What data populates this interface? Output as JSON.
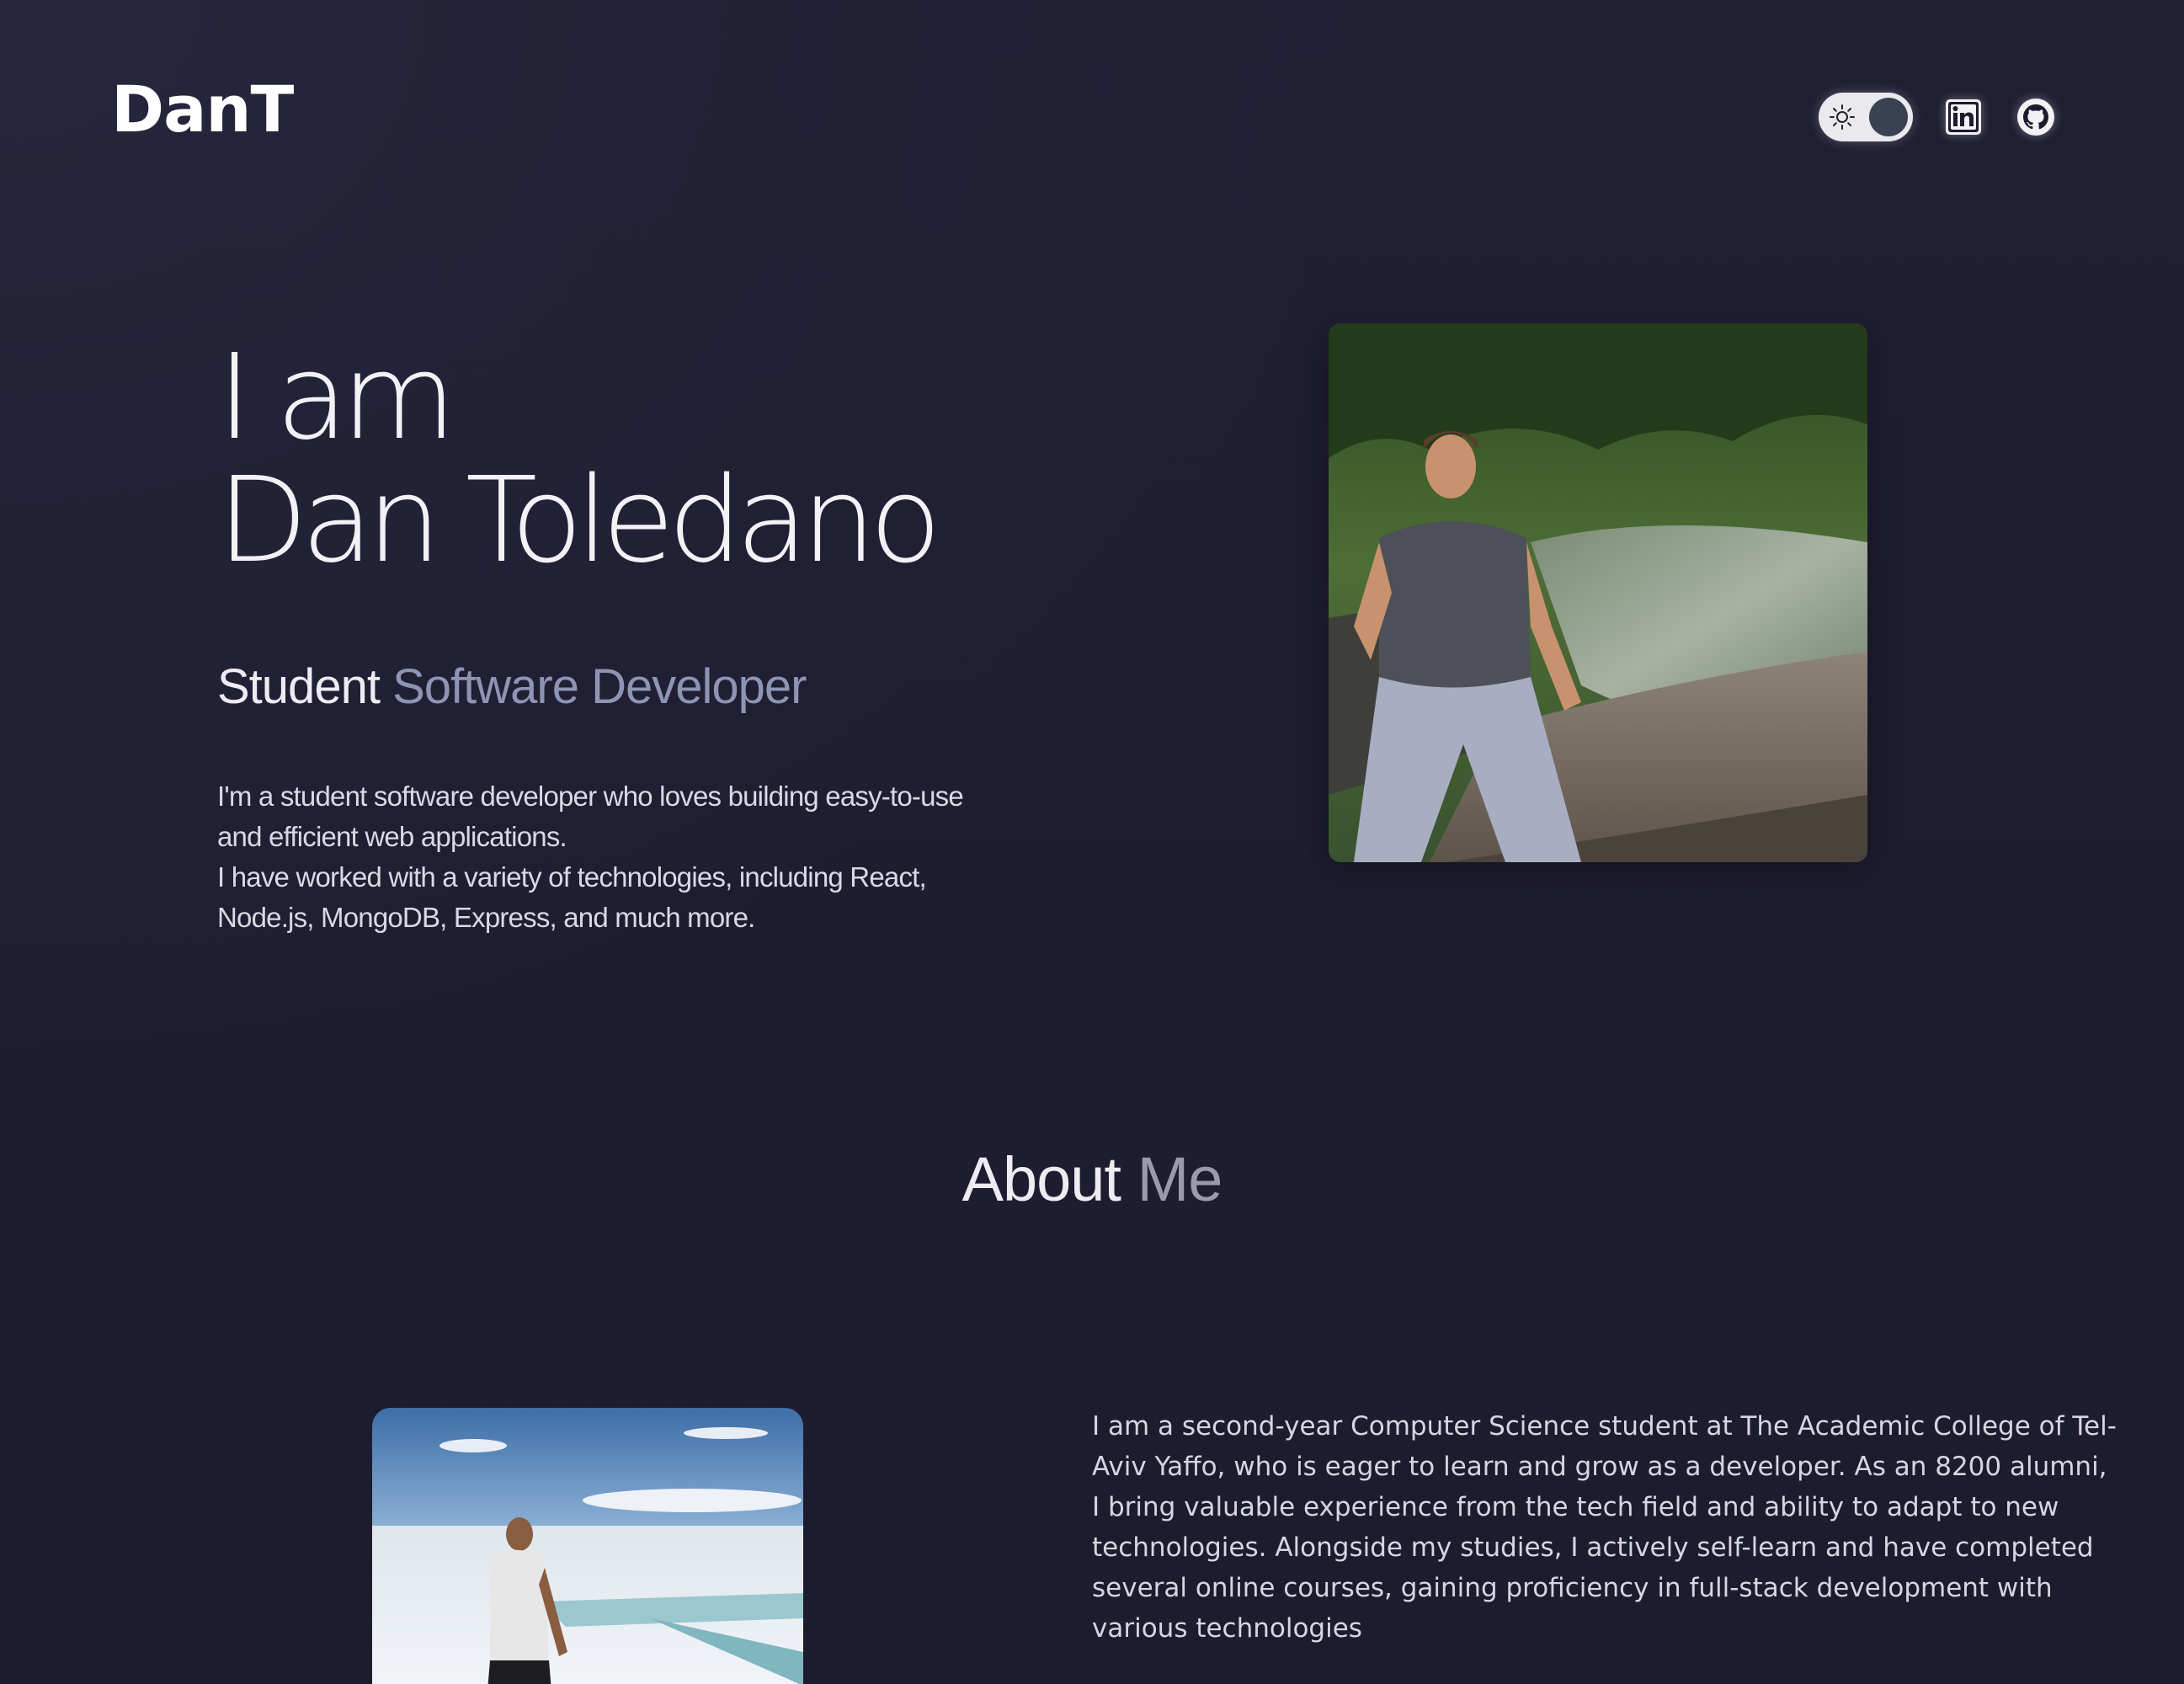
{
  "header": {
    "logo": "DanT",
    "theme_toggle_icon": "sun-icon",
    "social": [
      {
        "name": "linkedin-icon"
      },
      {
        "name": "github-icon"
      }
    ]
  },
  "hero": {
    "title_line1": "I am",
    "title_line2": "Dan Toledano",
    "subtitle_part1": "Student",
    "subtitle_part2": "Software Developer",
    "description_p1": "I'm a student software developer who loves building easy-to-use and efficient web applications.",
    "description_p2": "I have worked with a variety of technologies, including React, Node.js, MongoDB, Express, and much more."
  },
  "about": {
    "heading_part1": "About",
    "heading_part2": "Me",
    "text": "I am a second-year Computer Science student at The Academic College of Tel-Aviv Yaffo, who is eager to learn and grow as a developer. As an 8200 alumni, I bring valuable experience from the tech field and ability to adapt to new technologies. Alongside my studies, I actively self-learn and have completed several online courses, gaining proficiency in full-stack development with various technologies"
  },
  "colors": {
    "background": "#1d1c2f",
    "accent_muted": "#8d94b4",
    "text_primary": "#ececf2"
  }
}
